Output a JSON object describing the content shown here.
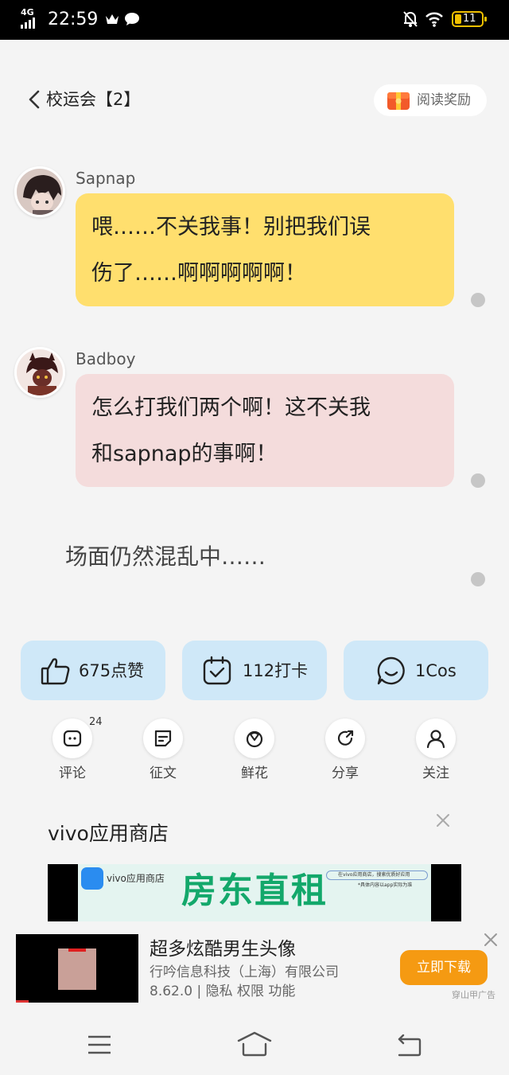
{
  "status_bar": {
    "network": "4G",
    "time": "22:59",
    "battery": "11",
    "icons": [
      "signal-icon",
      "crown-icon",
      "chat-icon",
      "bell-muted-icon",
      "wifi-icon",
      "battery-icon"
    ]
  },
  "header": {
    "title": "校运会【2】",
    "reward_label": "阅读奖励"
  },
  "messages": [
    {
      "sender": "Sapnap",
      "line1": "喂……不关我事！别把我们误",
      "line2": "伤了……啊啊啊啊啊！"
    },
    {
      "sender": "Badboy",
      "line1": "怎么打我们两个啊！这不关我",
      "line2": "和sapnap的事啊！"
    }
  ],
  "narration": "场面仍然混乱中……",
  "stats": {
    "likes": "675点赞",
    "checkins": "112打卡",
    "cos": "1Cos"
  },
  "actions": {
    "comment": "评论",
    "comment_count": "24",
    "contest": "征文",
    "flower": "鲜花",
    "share": "分享",
    "follow": "关注"
  },
  "ad": {
    "store_name": "vivo应用商店",
    "banner_store": "vivo应用商店",
    "banner_search": "在vivo应用商店，搜索优质好应用",
    "banner_sub": "*具体内容以app实际为准",
    "banner_headline": "房东直租",
    "app_title": "超多炫酷男生头像",
    "company": "行吟信息科技（上海）有限公司",
    "meta": "8.62.0 | 隐私  权限  功能",
    "download": "立即下载",
    "source": "穿山甲广告"
  },
  "colors": {
    "yellow_bubble": "#ffdf6e",
    "pink_bubble": "#f4dcdc",
    "stat_bg": "#cfe8f8",
    "download_btn": "#f59a12"
  }
}
